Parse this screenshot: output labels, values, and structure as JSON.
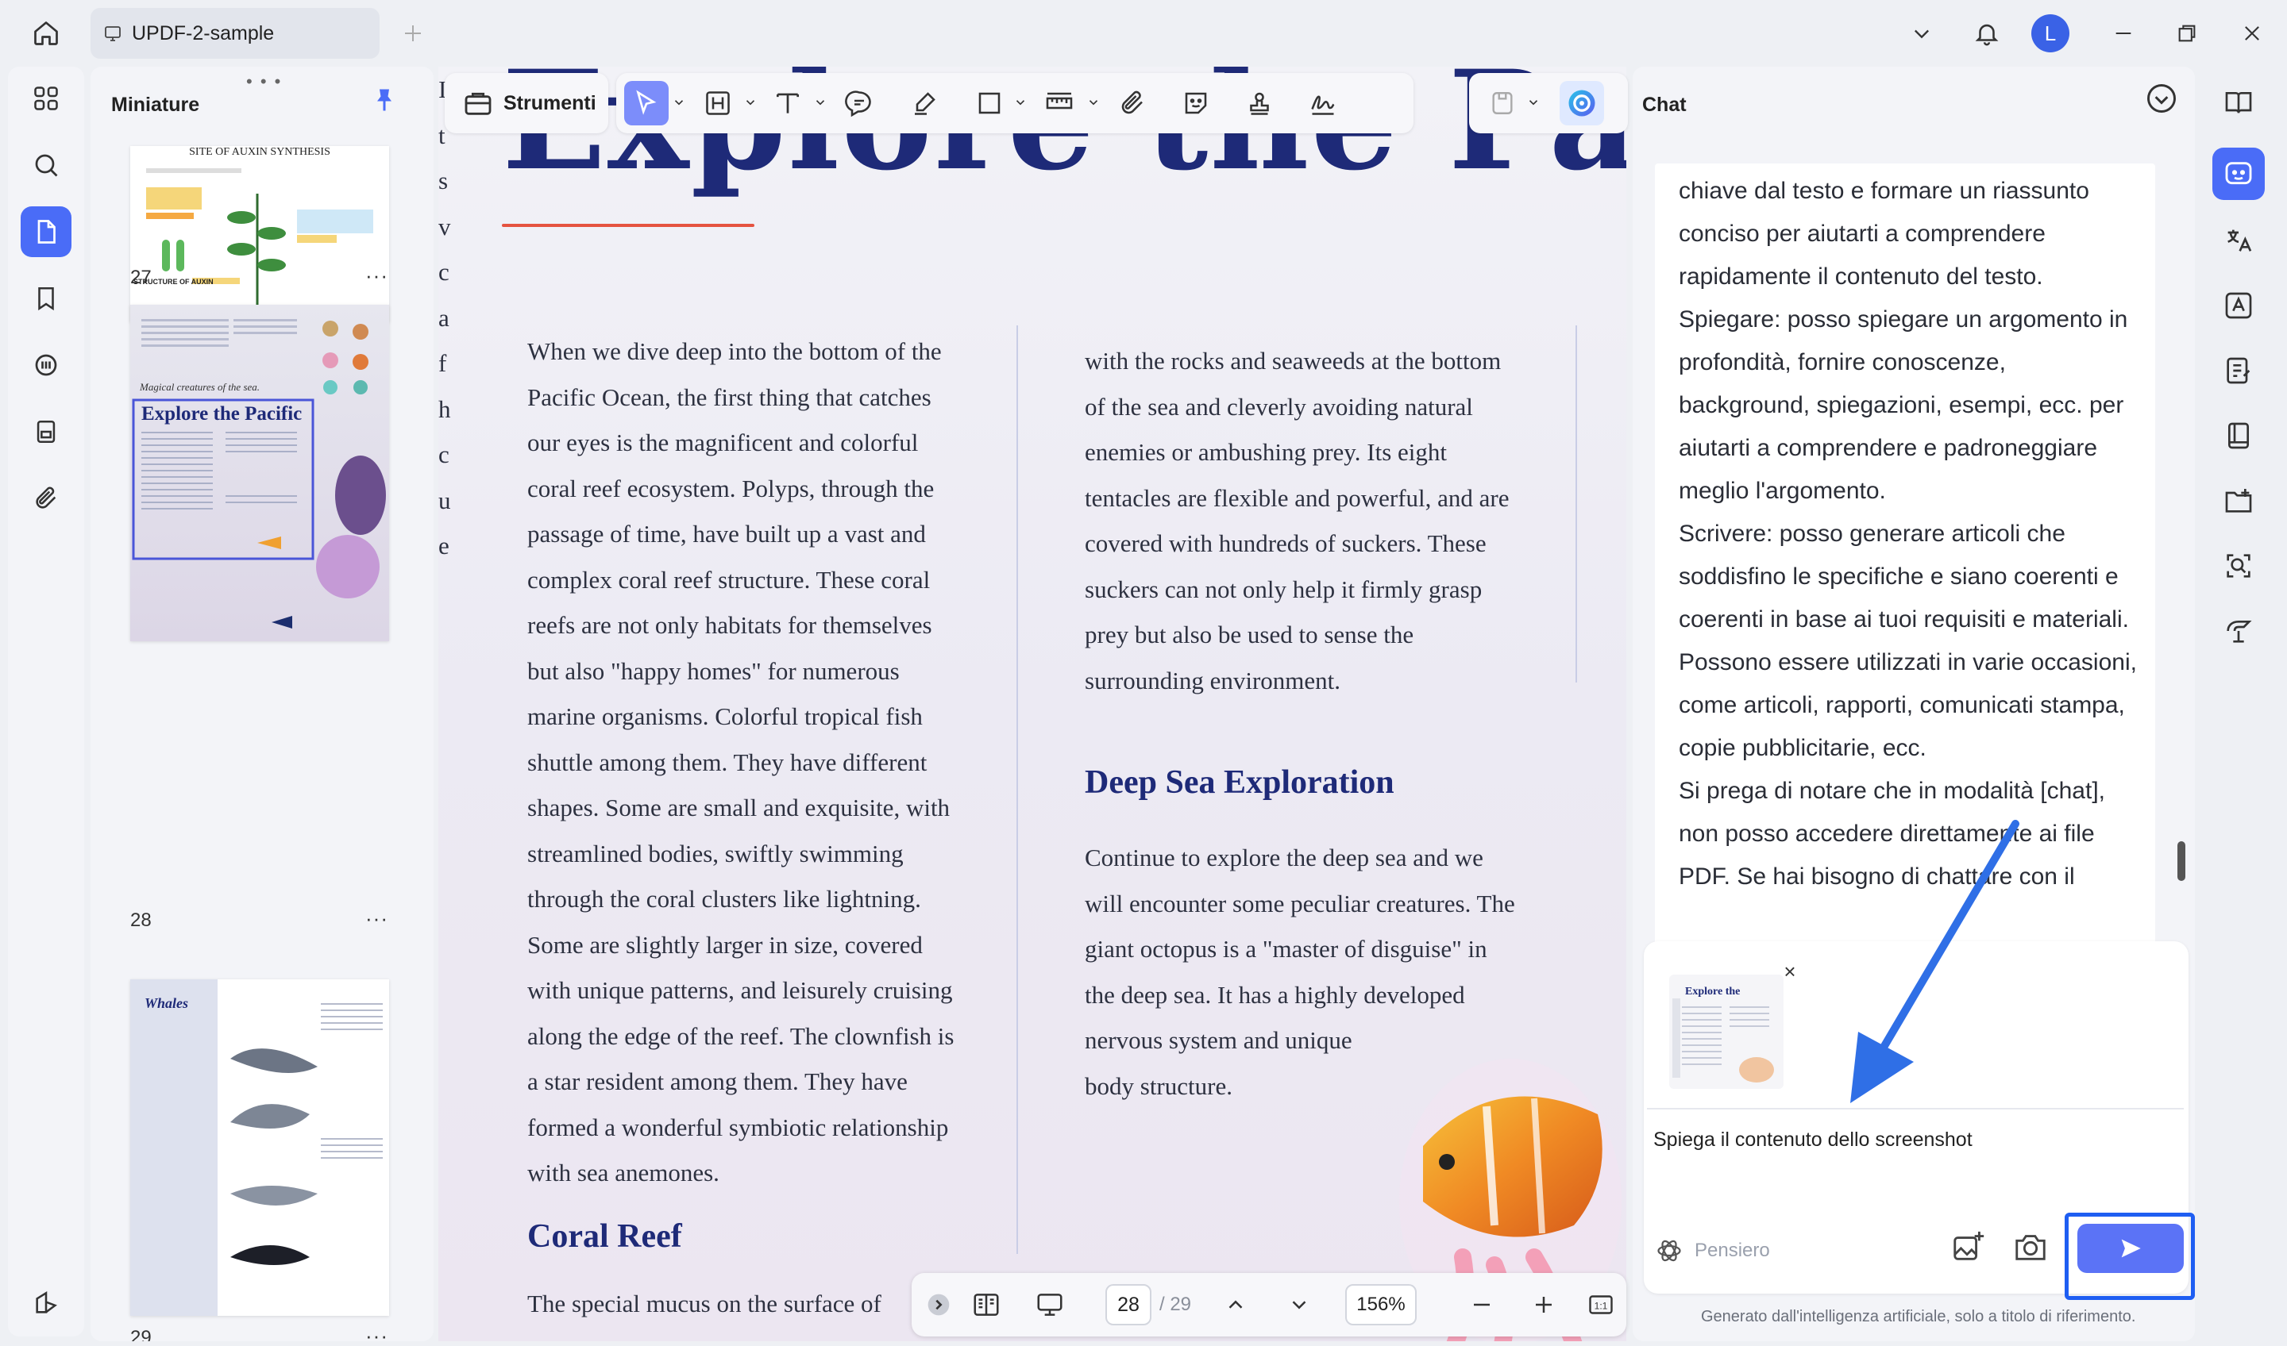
{
  "titlebar": {
    "tab_title": "UPDF-2-sample",
    "avatar_letter": "L"
  },
  "thumbnails": {
    "title": "Miniature",
    "handle": "• • •",
    "pages": [
      {
        "number": "27",
        "heading": "SITE OF AUXIN SYNTHESIS",
        "structure_label": "STRUCTURE OF AUXIN",
        "more": "···"
      },
      {
        "number": "28",
        "heading": "Explore the Pacific",
        "caption": "Magical creatures of the sea.",
        "more": "···"
      },
      {
        "number": "29",
        "heading": "Whales",
        "more": "···"
      }
    ]
  },
  "toolbar": {
    "strumenti_label": "Strumenti"
  },
  "document": {
    "heading": "Explore the Pacific",
    "col1": [
      "When we dive deep into the bottom of the",
      "Pacific Ocean, the first thing that catches",
      "our eyes is the magnificent and colorful",
      "coral reef ecosystem. Polyps, through the",
      "passage of time, have built up a vast and",
      "complex coral reef structure. These coral",
      "reefs are not only habitats for themselves",
      "but also \"happy homes\" for numerous",
      "marine organisms. Colorful tropical fish",
      "shuttle among them. They have different",
      "shapes. Some are small and exquisite, with",
      "streamlined bodies, swiftly swimming",
      "through the coral clusters like lightning.",
      "Some are slightly larger in size, covered",
      "with unique patterns, and leisurely cruising",
      "along the edge of the reef. The clownfish is",
      "a star resident among them. They have",
      "formed a wonderful symbiotic relationship",
      "with sea anemones."
    ],
    "col2": [
      "with the rocks and seaweeds at the bottom",
      "of the sea and cleverly avoiding natural",
      "enemies or ambushing prey. Its eight",
      "tentacles are flexible and powerful, and are",
      "covered with hundreds of suckers. These",
      "suckers can not only help it firmly grasp",
      "prey but also be used to sense the",
      "surrounding environment."
    ],
    "deep_sea_heading": "Deep Sea Exploration",
    "col2b": [
      "Continue to explore the deep sea and we",
      "will encounter some peculiar creatures. The",
      "giant octopus is a \"master of disguise\" in",
      "the deep sea. It has a highly developed",
      "nervous system and unique",
      "body structure."
    ],
    "coral_heading": "Coral Reef",
    "col3": [
      "The special mucus on the surface of"
    ],
    "col4": [
      "I",
      "t",
      "s",
      "v",
      "c",
      "a",
      "f",
      "h",
      "c",
      "u",
      "e"
    ]
  },
  "page_nav": {
    "current_page": "28",
    "total": "/ 29",
    "zoom": "156%"
  },
  "chat": {
    "title": "Chat",
    "message_lines": [
      "chiave dal testo e formare un riassunto",
      "conciso per aiutarti a comprendere",
      "rapidamente il contenuto del testo.",
      "Spiegare: posso spiegare un argomento in",
      "profondità, fornire conoscenze,",
      "background, spiegazioni, esempi, ecc. per",
      "aiutarti a comprendere e padroneggiare",
      "meglio l'argomento.",
      "Scrivere: posso generare articoli che",
      "soddisfino le specifiche e siano coerenti e",
      "coerenti in base ai tuoi requisiti e materiali.",
      "Possono essere utilizzati in varie occasioni,",
      "come articoli, rapporti, comunicati stampa,",
      "copie pubblicitarie, ecc.",
      "Si prega di notare che in modalità [chat],",
      "non posso accedere direttamente ai file",
      "PDF. Se hai bisogno di chattare con il"
    ],
    "input_text": "Spiega il contenuto dello screenshot",
    "attachment_close": "×",
    "pensiero_label": "Pensiero",
    "footer": "Generato dall'intelligenza artificiale, solo a titolo di riferimento.",
    "attachment_heading": "Explore the"
  },
  "colors": {
    "accent": "#4a6cf7",
    "heading_navy": "#1e2a78",
    "send_frame": "#1e5ef2",
    "underline": "#e55340"
  }
}
